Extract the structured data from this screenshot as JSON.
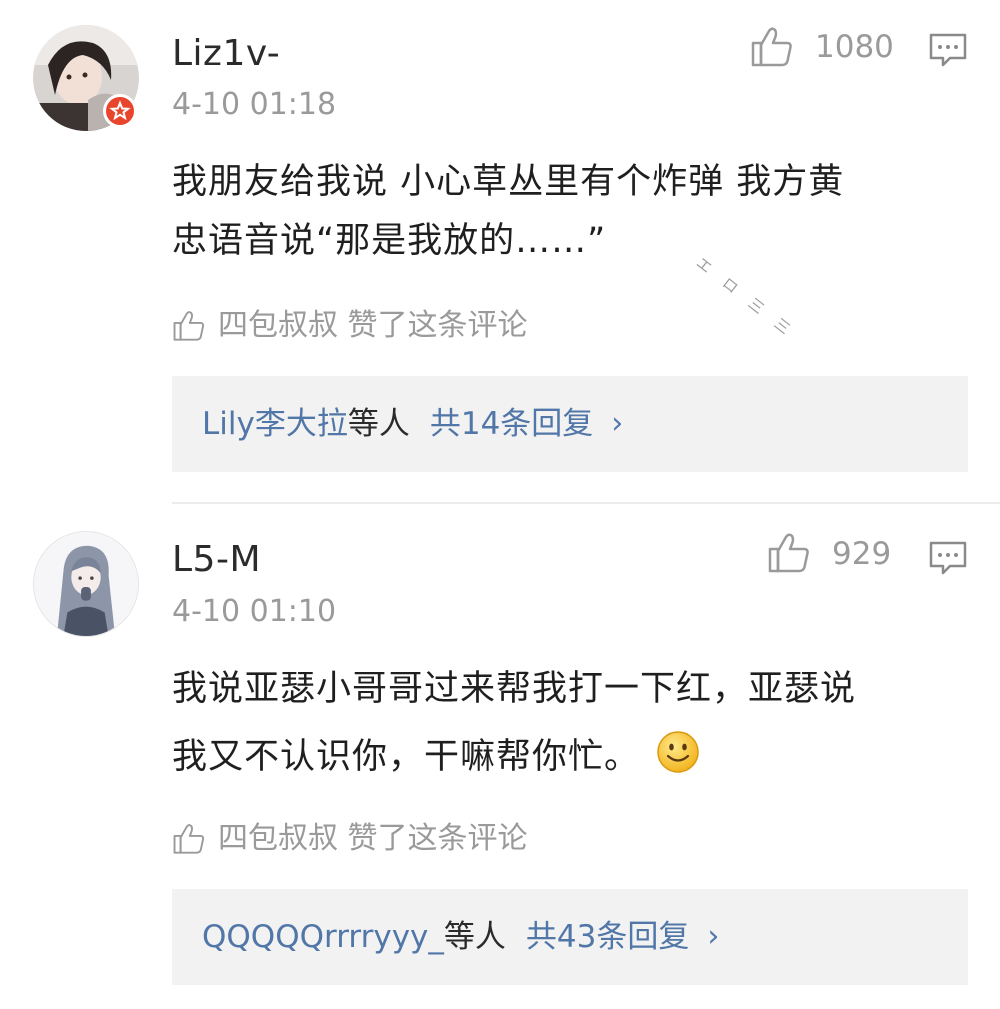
{
  "comments": [
    {
      "username": "Liz1v-",
      "timestamp": "4-10 01:18",
      "like_count": "1080",
      "text_lines": [
        "我朋友给我说 小心草丛里有个炸弹 我方黄",
        "忠语音说“那是我放的……”"
      ],
      "liked_by": "四包叔叔 赞了这条评论",
      "reply_users": "Lily李大拉",
      "reply_suffix": "等人",
      "reply_count": "共14条回复",
      "reply_chevron": "›"
    },
    {
      "username": "L5-M",
      "timestamp": "4-10 01:10",
      "like_count": "929",
      "text_lines": [
        "我说亚瑟小哥哥过来帮我打一下红，亚瑟说",
        "我又不认识你，干嘛帮你忙。"
      ],
      "liked_by": "四包叔叔 赞了这条评论",
      "reply_users": "QQQQQrrrryyy_",
      "reply_suffix": "等人",
      "reply_count": "共43条回复",
      "reply_chevron": "›"
    }
  ],
  "watermark": "エロ三三",
  "icons": {
    "like": "thumbs-up-icon",
    "reply": "comment-bubble-icon",
    "verified": "verified-badge-icon",
    "emoji": "smiley-emoji-icon"
  },
  "colors": {
    "link": "#5176a8",
    "meta_text": "#9a9a9a",
    "reply_box_bg": "#f2f2f2",
    "badge": "#e8452c"
  }
}
